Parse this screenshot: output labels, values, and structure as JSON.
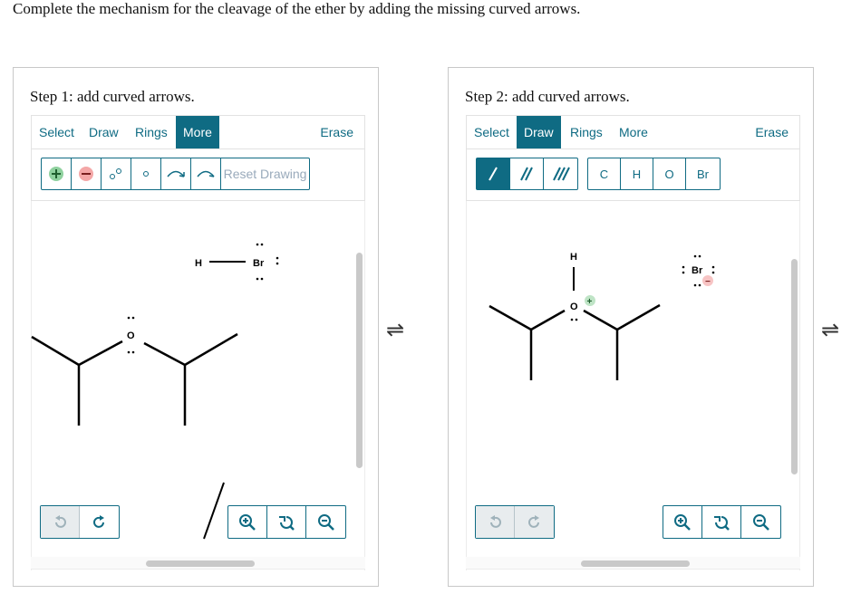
{
  "instruction": "Complete the mechanism for the cleavage of the ether by adding the missing curved arrows.",
  "step1": {
    "heading": "Step 1: add curved arrows.",
    "tabs": [
      "Select",
      "Draw",
      "Rings",
      "More"
    ],
    "active_tab": "More",
    "erase_label": "Erase",
    "tools": [
      "plus-charge",
      "minus-charge",
      "radical-pair",
      "radical-single",
      "single-electron-arrow",
      "electron-pair-arrow"
    ],
    "reset_label": "Reset Drawing",
    "atoms": {
      "H": "H",
      "Br": "Br",
      "O": "O"
    }
  },
  "step2": {
    "heading": "Step 2: add curved arrows.",
    "tabs": [
      "Select",
      "Draw",
      "Rings",
      "More"
    ],
    "active_tab": "Draw",
    "erase_label": "Erase",
    "bond_tools": [
      "single-bond",
      "double-bond",
      "triple-bond"
    ],
    "elements": [
      "C",
      "H",
      "O",
      "Br"
    ],
    "atoms": {
      "H": "H",
      "O": "O",
      "Br": "Br",
      "plus": "+",
      "minus": "−"
    }
  },
  "equilibrium_symbol": "⇌",
  "colors": {
    "accent": "#0f6b83",
    "plus_bg": "#8fd19e",
    "minus_bg": "#f4a7a7"
  }
}
